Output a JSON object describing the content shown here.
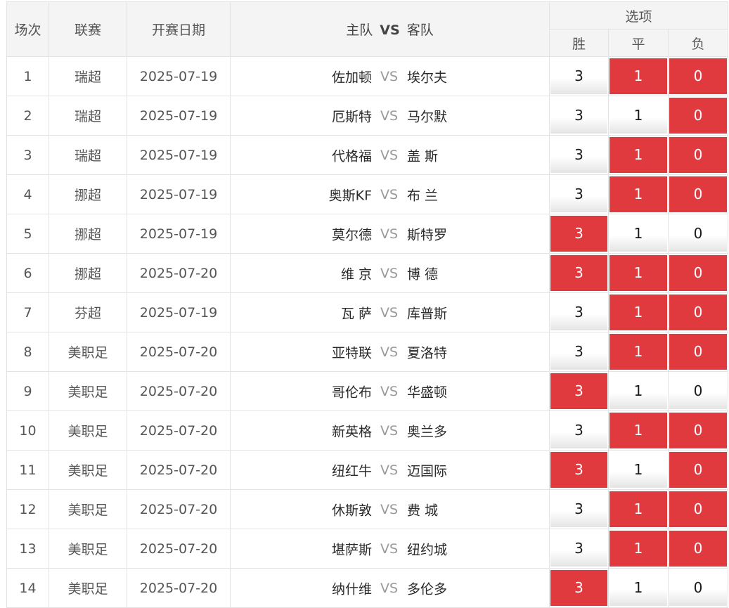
{
  "header": {
    "col_index": "场次",
    "col_league": "联赛",
    "col_date": "开赛日期",
    "col_home": "主队",
    "col_vs": "VS",
    "col_away": "客队",
    "col_options": "选项",
    "opt_win": "胜",
    "opt_draw": "平",
    "opt_lose": "负"
  },
  "colors": {
    "selected": "#e03a3e",
    "header_bg": "#f4f4f4",
    "border": "#e3e3e3"
  },
  "rows": [
    {
      "num": "1",
      "league": "瑞超",
      "date": "2025-07-19",
      "home": "佐加顿",
      "vs": "VS",
      "away": "埃尔夫",
      "win": "3",
      "draw": "1",
      "lose": "0",
      "sel": [
        false,
        true,
        true
      ]
    },
    {
      "num": "2",
      "league": "瑞超",
      "date": "2025-07-19",
      "home": "厄斯特",
      "vs": "VS",
      "away": "马尔默",
      "win": "3",
      "draw": "1",
      "lose": "0",
      "sel": [
        false,
        false,
        true
      ]
    },
    {
      "num": "3",
      "league": "瑞超",
      "date": "2025-07-19",
      "home": "代格福",
      "vs": "VS",
      "away": "盖 斯",
      "win": "3",
      "draw": "1",
      "lose": "0",
      "sel": [
        false,
        true,
        true
      ]
    },
    {
      "num": "4",
      "league": "挪超",
      "date": "2025-07-19",
      "home": "奥斯KF",
      "vs": "VS",
      "away": "布 兰",
      "win": "3",
      "draw": "1",
      "lose": "0",
      "sel": [
        false,
        true,
        true
      ]
    },
    {
      "num": "5",
      "league": "挪超",
      "date": "2025-07-19",
      "home": "莫尔德",
      "vs": "VS",
      "away": "斯特罗",
      "win": "3",
      "draw": "1",
      "lose": "0",
      "sel": [
        true,
        false,
        false
      ]
    },
    {
      "num": "6",
      "league": "挪超",
      "date": "2025-07-20",
      "home": "维 京",
      "vs": "VS",
      "away": "博 德",
      "win": "3",
      "draw": "1",
      "lose": "0",
      "sel": [
        true,
        true,
        true
      ]
    },
    {
      "num": "7",
      "league": "芬超",
      "date": "2025-07-19",
      "home": "瓦 萨",
      "vs": "VS",
      "away": "库普斯",
      "win": "3",
      "draw": "1",
      "lose": "0",
      "sel": [
        false,
        true,
        true
      ]
    },
    {
      "num": "8",
      "league": "美职足",
      "date": "2025-07-20",
      "home": "亚特联",
      "vs": "VS",
      "away": "夏洛特",
      "win": "3",
      "draw": "1",
      "lose": "0",
      "sel": [
        false,
        true,
        true
      ]
    },
    {
      "num": "9",
      "league": "美职足",
      "date": "2025-07-20",
      "home": "哥伦布",
      "vs": "VS",
      "away": "华盛顿",
      "win": "3",
      "draw": "1",
      "lose": "0",
      "sel": [
        true,
        false,
        false
      ]
    },
    {
      "num": "10",
      "league": "美职足",
      "date": "2025-07-20",
      "home": "新英格",
      "vs": "VS",
      "away": "奥兰多",
      "win": "3",
      "draw": "1",
      "lose": "0",
      "sel": [
        false,
        true,
        true
      ]
    },
    {
      "num": "11",
      "league": "美职足",
      "date": "2025-07-20",
      "home": "纽红牛",
      "vs": "VS",
      "away": "迈国际",
      "win": "3",
      "draw": "1",
      "lose": "0",
      "sel": [
        true,
        false,
        true
      ]
    },
    {
      "num": "12",
      "league": "美职足",
      "date": "2025-07-20",
      "home": "休斯敦",
      "vs": "VS",
      "away": "费 城",
      "win": "3",
      "draw": "1",
      "lose": "0",
      "sel": [
        false,
        true,
        true
      ]
    },
    {
      "num": "13",
      "league": "美职足",
      "date": "2025-07-20",
      "home": "堪萨斯",
      "vs": "VS",
      "away": "纽约城",
      "win": "3",
      "draw": "1",
      "lose": "0",
      "sel": [
        false,
        true,
        true
      ]
    },
    {
      "num": "14",
      "league": "美职足",
      "date": "2025-07-20",
      "home": "纳什维",
      "vs": "VS",
      "away": "多伦多",
      "win": "3",
      "draw": "1",
      "lose": "0",
      "sel": [
        true,
        false,
        false
      ]
    }
  ]
}
